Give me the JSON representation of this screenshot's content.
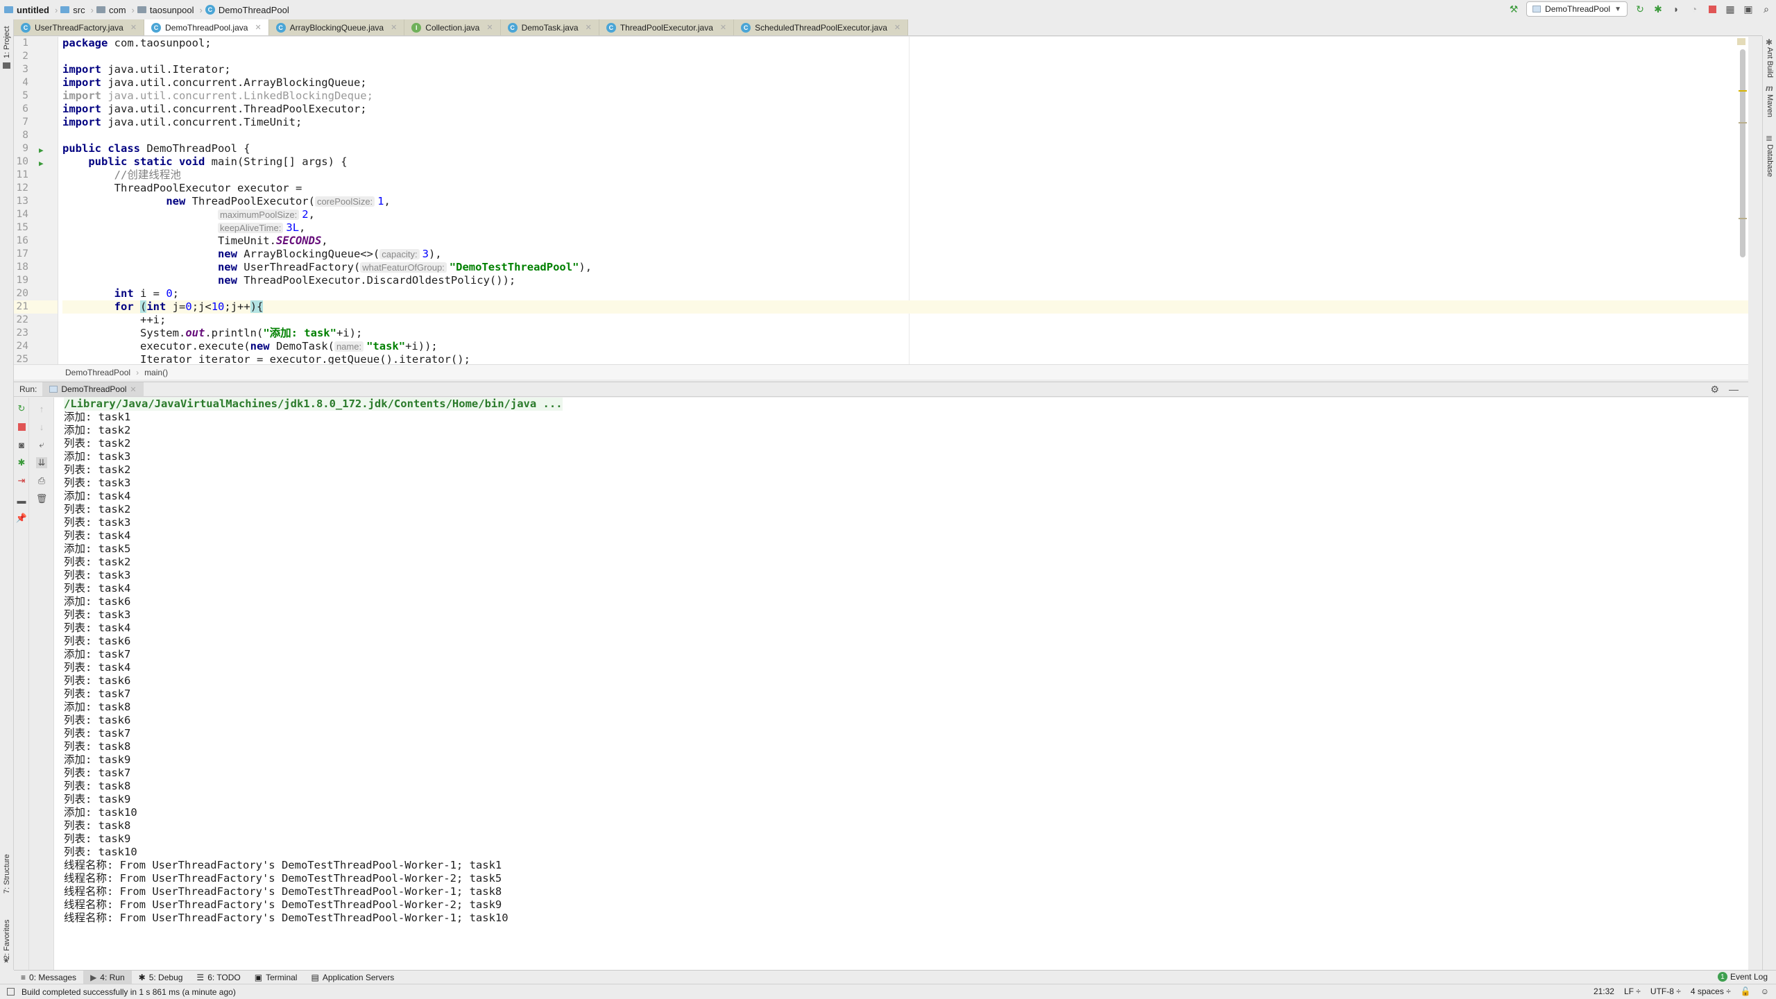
{
  "navbar": {
    "crumbs": [
      "untitled",
      "src",
      "com",
      "taosunpool",
      "DemoThreadPool"
    ]
  },
  "toolbar": {
    "run_config": "DemoThreadPool",
    "icons": [
      "build-hammer-icon",
      "rerun-icon",
      "debug-icon",
      "coverage-icon",
      "profile-icon",
      "stop-icon",
      "project-structure-icon",
      "run-window-icon",
      "search-icon"
    ]
  },
  "tabs": [
    {
      "label": "UserThreadFactory.java",
      "icon": "C",
      "active": false
    },
    {
      "label": "DemoThreadPool.java",
      "icon": "C",
      "active": true
    },
    {
      "label": "ArrayBlockingQueue.java",
      "icon": "C",
      "active": false
    },
    {
      "label": "Collection.java",
      "icon": "I",
      "active": false
    },
    {
      "label": "DemoTask.java",
      "icon": "C",
      "active": false
    },
    {
      "label": "ThreadPoolExecutor.java",
      "icon": "C",
      "active": false
    },
    {
      "label": "ScheduledThreadPoolExecutor.java",
      "icon": "C",
      "active": false
    }
  ],
  "left_strip": {
    "project": "1: Project",
    "structure": "7: Structure",
    "favorites": "2: Favorites"
  },
  "right_strip": {
    "ant": "Ant Build",
    "maven": "Maven",
    "database": "Database"
  },
  "editor": {
    "line_numbers": [
      "1",
      "2",
      "3",
      "4",
      "5",
      "6",
      "7",
      "8",
      "9",
      "10",
      "11",
      "12",
      "13",
      "14",
      "15",
      "16",
      "17",
      "18",
      "19",
      "20",
      "21",
      "22",
      "23",
      "24",
      "25"
    ],
    "code": {
      "l1_kw": "package",
      "l1_rest": " com.taosunpool;",
      "l3_kw": "import",
      "l3_rest": " java.util.Iterator;",
      "l4_kw": "import",
      "l4_rest": " java.util.concurrent.ArrayBlockingQueue;",
      "l5_kw": "import",
      "l5_rest": " java.util.concurrent.LinkedBlockingDeque;",
      "l6_kw": "import",
      "l6_rest": " java.util.concurrent.ThreadPoolExecutor;",
      "l7_kw": "import",
      "l7_rest": " java.util.concurrent.TimeUnit;",
      "l9_kw": "public class",
      "l9_rest": " DemoThreadPool {",
      "l10_kw": "public static void",
      "l10_rest": " main(String[] args) {",
      "l11_cmt": "//创建线程池",
      "l12": "ThreadPoolExecutor executor =",
      "l13_kw": "new",
      "l13_rest": " ThreadPoolExecutor(",
      "l13_hint": "corePoolSize:",
      "l13_val": "1",
      "l13_end": ",",
      "l14_hint": "maximumPoolSize:",
      "l14_val": "2",
      "l14_end": ",",
      "l15_hint": "keepAliveTime:",
      "l15_val": "3L",
      "l15_end": ",",
      "l16_a": "TimeUnit.",
      "l16_const": "SECONDS",
      "l16_end": ",",
      "l17_kw": "new",
      "l17_rest": " ArrayBlockingQueue<>(",
      "l17_hint": "capacity:",
      "l17_val": "3",
      "l17_end": "),",
      "l18_kw": "new",
      "l18_rest": " UserThreadFactory(",
      "l18_hint": "whatFeaturOfGroup:",
      "l18_str": "\"DemoTestThreadPool\"",
      "l18_end": "),",
      "l19_kw": "new",
      "l19_rest": " ThreadPoolExecutor.DiscardOldestPolicy());",
      "l20_kw": "int",
      "l20_rest": " i = ",
      "l20_val": "0",
      "l20_end": ";",
      "l21_kw": "for",
      "l21_open": "(",
      "l21_kw2": "int",
      "l21_a": " j=",
      "l21_v0": "0",
      "l21_b": ";j<",
      "l21_v10": "10",
      "l21_c": ";j++",
      "l21_close": "){",
      "l22": "++i;",
      "l23_a": "System.",
      "l23_out": "out",
      "l23_b": ".println(",
      "l23_str": "\"添加: task\"",
      "l23_c": "+i);",
      "l24_a": "executor.execute(",
      "l24_kw": "new",
      "l24_b": " DemoTask(",
      "l24_hint": "name:",
      "l24_str": "\"task\"",
      "l24_c": "+i));",
      "l25": "Iterator iterator = executor.getQueue().iterator();"
    },
    "current_line": 21
  },
  "editor_breadcrumb": [
    "DemoThreadPool",
    "main()"
  ],
  "run_panel": {
    "label": "Run:",
    "tab": "DemoThreadPool",
    "command": "/Library/Java/JavaVirtualMachines/jdk1.8.0_172.jdk/Contents/Home/bin/java ...",
    "output": [
      "添加: task1",
      "添加: task2",
      "列表: task2",
      "添加: task3",
      "列表: task2",
      "列表: task3",
      "添加: task4",
      "列表: task2",
      "列表: task3",
      "列表: task4",
      "添加: task5",
      "列表: task2",
      "列表: task3",
      "列表: task4",
      "添加: task6",
      "列表: task3",
      "列表: task4",
      "列表: task6",
      "添加: task7",
      "列表: task4",
      "列表: task6",
      "列表: task7",
      "添加: task8",
      "列表: task6",
      "列表: task7",
      "列表: task8",
      "添加: task9",
      "列表: task7",
      "列表: task8",
      "列表: task9",
      "添加: task10",
      "列表: task8",
      "列表: task9",
      "列表: task10",
      "线程名称: From UserThreadFactory's DemoTestThreadPool-Worker-1; task1",
      "线程名称: From UserThreadFactory's DemoTestThreadPool-Worker-2; task5",
      "线程名称: From UserThreadFactory's DemoTestThreadPool-Worker-1; task8",
      "线程名称: From UserThreadFactory's DemoTestThreadPool-Worker-2; task9",
      "线程名称: From UserThreadFactory's DemoTestThreadPool-Worker-1; task10"
    ]
  },
  "bottom_tools": [
    {
      "label": "0: Messages",
      "icon": "≡",
      "active": false
    },
    {
      "label": "4: Run",
      "icon": "▶",
      "active": true
    },
    {
      "label": "5: Debug",
      "icon": "✱",
      "active": false
    },
    {
      "label": "6: TODO",
      "icon": "☰",
      "active": false
    },
    {
      "label": "Terminal",
      "icon": "▣",
      "active": false
    },
    {
      "label": "Application Servers",
      "icon": "▤",
      "active": false
    }
  ],
  "event_log": {
    "count": "1",
    "label": "Event Log"
  },
  "status": {
    "message": "Build completed successfully in 1 s 861 ms (a minute ago)",
    "position": "21:32",
    "line_sep": "LF ÷",
    "encoding": "UTF-8 ÷",
    "indent": "4 spaces ÷"
  },
  "colors": {
    "accent_green": "#3e9f4f",
    "stop_red": "#e05555",
    "keyword": "#000080",
    "string": "#008000"
  }
}
